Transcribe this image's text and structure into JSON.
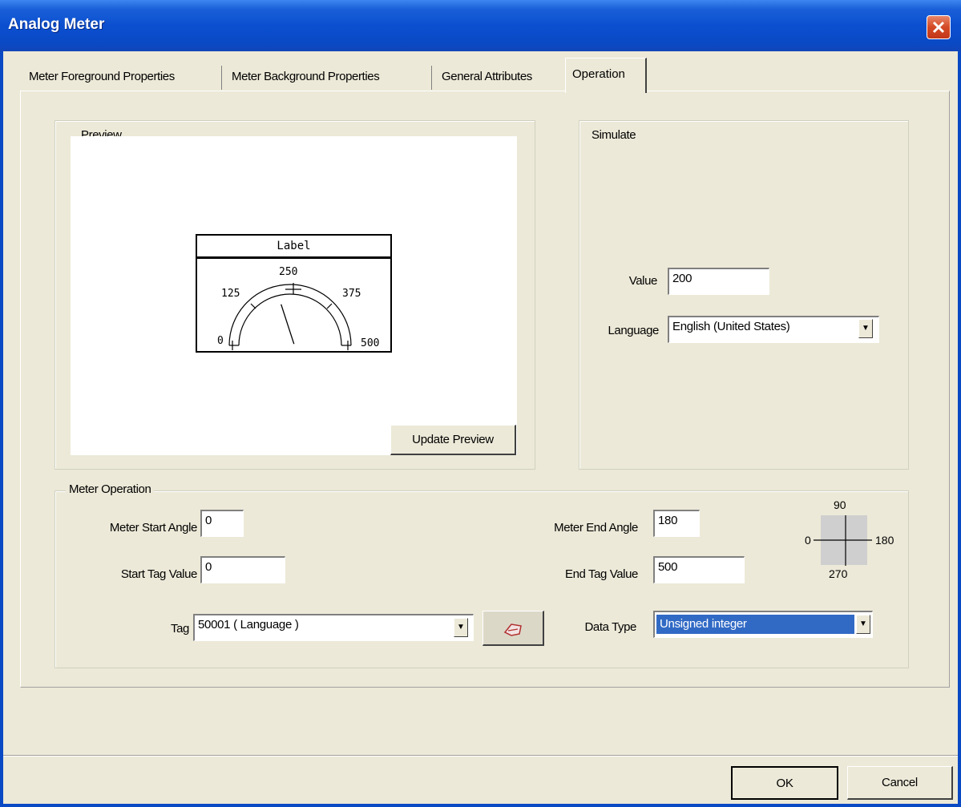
{
  "window": {
    "title": "Analog Meter"
  },
  "tabs": [
    {
      "label": "Meter Foreground Properties"
    },
    {
      "label": "Meter Background Properties"
    },
    {
      "label": "General Attributes"
    },
    {
      "label": "Operation"
    }
  ],
  "preview": {
    "group_label": "Preview",
    "meter": {
      "label": "Label",
      "ticks": [
        "0",
        "125",
        "250",
        "375",
        "500"
      ],
      "needle_value": 200
    },
    "update_button": "Update Preview"
  },
  "simulate": {
    "group_label": "Simulate",
    "value_label": "Value",
    "value": "200",
    "language_label": "Language",
    "language": "English (United States)"
  },
  "operation": {
    "group_label": "Meter Operation",
    "start_angle_label": "Meter Start Angle",
    "start_angle": "0",
    "end_angle_label": "Meter End Angle",
    "end_angle": "180",
    "start_tag_label": "Start Tag Value",
    "start_tag": "0",
    "end_tag_label": "End Tag Value",
    "end_tag": "500",
    "tag_label": "Tag",
    "tag": "50001 ( Language )",
    "data_type_label": "Data Type",
    "data_type": "Unsigned integer",
    "angle_diagram": {
      "top": "90",
      "left": "0",
      "right": "180",
      "bottom": "270"
    }
  },
  "footer": {
    "ok": "OK",
    "cancel": "Cancel"
  },
  "colors": {
    "title_bar": "#0a49c4",
    "selection": "#316ac5",
    "dialog_bg": "#ece9d8"
  }
}
